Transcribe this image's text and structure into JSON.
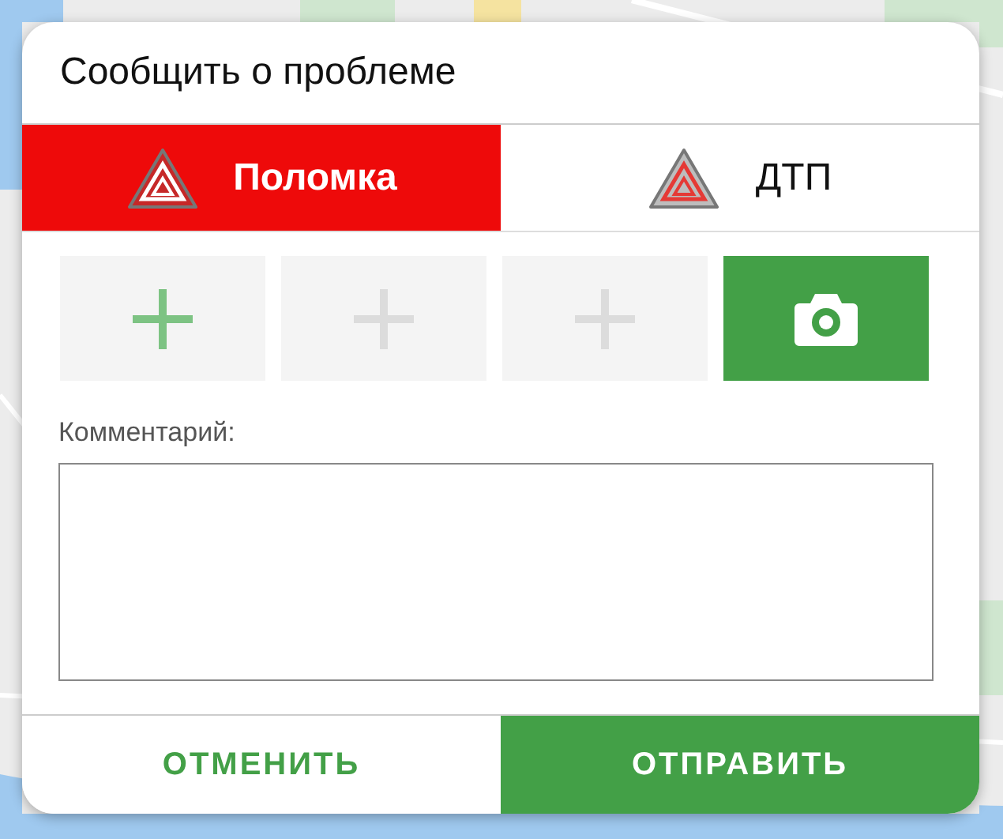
{
  "dialog": {
    "title": "Сообщить о проблеме",
    "tabs": [
      {
        "label": "Поломка",
        "selected": true
      },
      {
        "label": "ДТП",
        "selected": false
      }
    ],
    "photo_slots": [
      {
        "kind": "add",
        "disabled": false
      },
      {
        "kind": "add",
        "disabled": true
      },
      {
        "kind": "add",
        "disabled": true
      },
      {
        "kind": "camera"
      }
    ],
    "comment": {
      "label": "Комментарий:"
    },
    "buttons": [
      {
        "kind": "cancel",
        "label": "ОТМЕНИТЬ"
      },
      {
        "kind": "submit",
        "label": "ОТПРАВИТЬ"
      }
    ]
  }
}
